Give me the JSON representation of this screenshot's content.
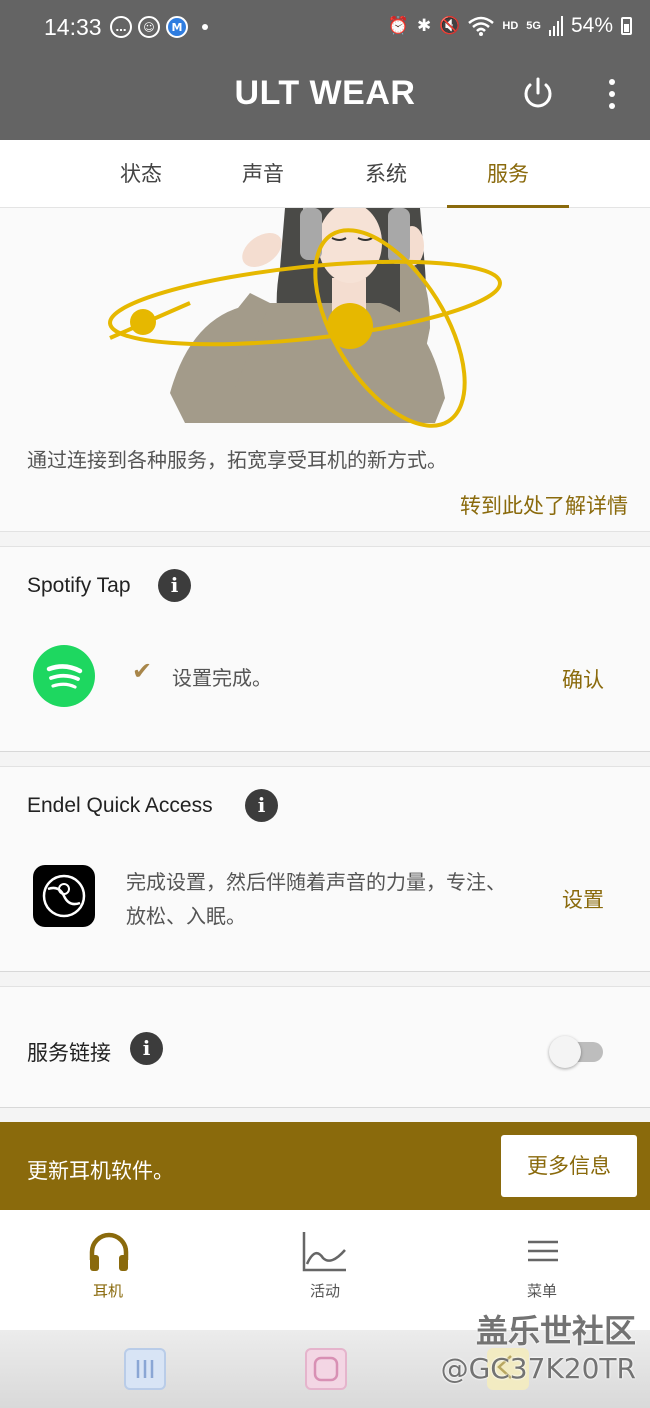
{
  "status_bar": {
    "time": "14:33",
    "battery": "54%",
    "network": "5G",
    "hd": "HD",
    "left_icons": [
      "chat-icon",
      "smiley-icon",
      "m-app-icon"
    ],
    "right_icons": [
      "alarm-icon",
      "bluetooth-icon",
      "mute-icon",
      "wifi-icon",
      "signal-icon",
      "battery-icon"
    ]
  },
  "app_bar": {
    "title": "ULT WEAR"
  },
  "tabs": [
    {
      "label": "状态"
    },
    {
      "label": "声音"
    },
    {
      "label": "系统"
    },
    {
      "label": "服务",
      "active": true
    }
  ],
  "hero": {
    "description": "通过连接到各种服务，拓宽享受耳机的新方式。",
    "link": "转到此处了解详情"
  },
  "spotify": {
    "title": "Spotify Tap",
    "status": "设置完成。",
    "action": "确认"
  },
  "endel": {
    "title": "Endel Quick Access",
    "description": "完成设置，然后伴随着声音的力量，专注、放松、入眠。",
    "action": "设置"
  },
  "service_link": {
    "title": "服务链接",
    "enabled": false
  },
  "banner": {
    "text": "更新耳机软件。",
    "button": "更多信息"
  },
  "bottom_nav": [
    {
      "label": "耳机",
      "icon": "headphones-icon",
      "active": true
    },
    {
      "label": "活动",
      "icon": "chart-icon"
    },
    {
      "label": "菜单",
      "icon": "menu-icon"
    }
  ],
  "watermark": {
    "line1": "盖乐世社区",
    "line2": "@GC37K20TR"
  },
  "colors": {
    "accent": "#8a6a0c",
    "app_bar": "#646464",
    "spotify": "#1ed760",
    "illustration_yellow": "#e6b800"
  }
}
